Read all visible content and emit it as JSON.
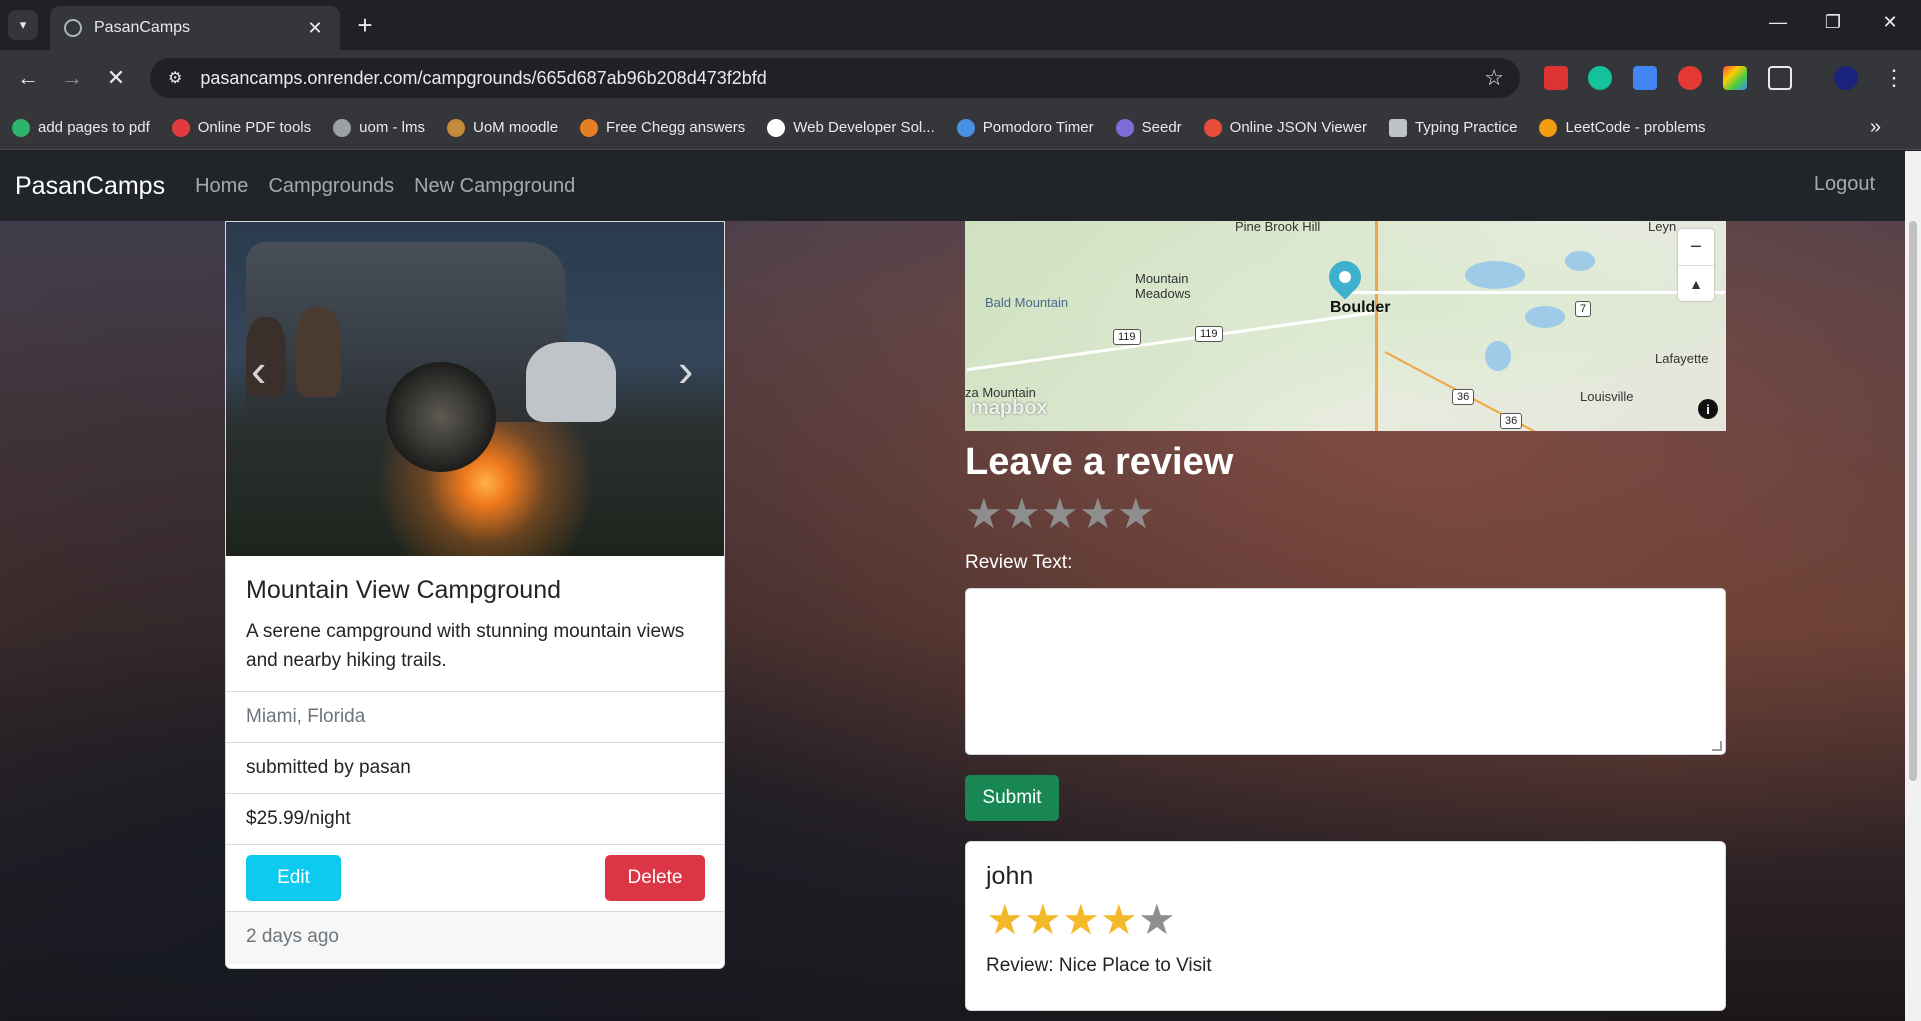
{
  "browser": {
    "tab_title": "PasanCamps",
    "url": "pasancamps.onrender.com/campgrounds/665d687ab96b208d473f2bfd",
    "bookmarks": [
      {
        "label": "add pages to pdf",
        "color": "#2fb56a"
      },
      {
        "label": "Online PDF tools",
        "color": "#e23b3b"
      },
      {
        "label": "uom - lms",
        "color": "#9aa0a6"
      },
      {
        "label": "UoM moodle",
        "color": "#c28a3a"
      },
      {
        "label": "Free Chegg answers",
        "color": "#e67e22"
      },
      {
        "label": "Web Developer Sol...",
        "color": "#ffffff"
      },
      {
        "label": "Pomodoro Timer",
        "color": "#4a90e2"
      },
      {
        "label": "Seedr",
        "color": "#7b6cd9"
      },
      {
        "label": "Online JSON Viewer",
        "color": "#e74c3c"
      },
      {
        "label": "Typing Practice",
        "color": "#bdc3c7"
      },
      {
        "label": "LeetCode - problems",
        "color": "#f39c12"
      }
    ]
  },
  "navbar": {
    "brand": "PasanCamps",
    "links": [
      "Home",
      "Campgrounds",
      "New Campground"
    ],
    "logout": "Logout"
  },
  "campground": {
    "title": "Mountain View Campground",
    "description": "A serene campground with stunning mountain views and nearby hiking trails.",
    "location": "Miami, Florida",
    "submitted_by": "submitted by pasan",
    "price": "$25.99/night",
    "edit_label": "Edit",
    "delete_label": "Delete",
    "posted": "2 days ago"
  },
  "map": {
    "labels": {
      "pine_brook": "Pine Brook Hill",
      "mountain_meadows": "Mountain Meadows",
      "bald_mountain": "Bald Mountain",
      "boulder": "Boulder",
      "lafayette": "Lafayette",
      "louisville": "Louisville",
      "za_mountain": "za Mountain",
      "leyn": "Leyn",
      "route_119a": "119",
      "route_119b": "119",
      "route_7": "7",
      "route_36a": "36",
      "route_36b": "36"
    },
    "attribution": "mapbox"
  },
  "review_form": {
    "heading": "Leave a review",
    "label": "Review Text:",
    "submit_label": "Submit",
    "star_count": 5
  },
  "reviews": [
    {
      "author": "john",
      "rating": 4,
      "text": "Review: Nice Place to Visit"
    }
  ],
  "colors": {
    "navbar": "#212529",
    "edit": "#0dcaf0",
    "delete": "#dc3545",
    "submit": "#198754",
    "star_filled": "#f3b928",
    "star_empty": "#8e8e8e"
  }
}
